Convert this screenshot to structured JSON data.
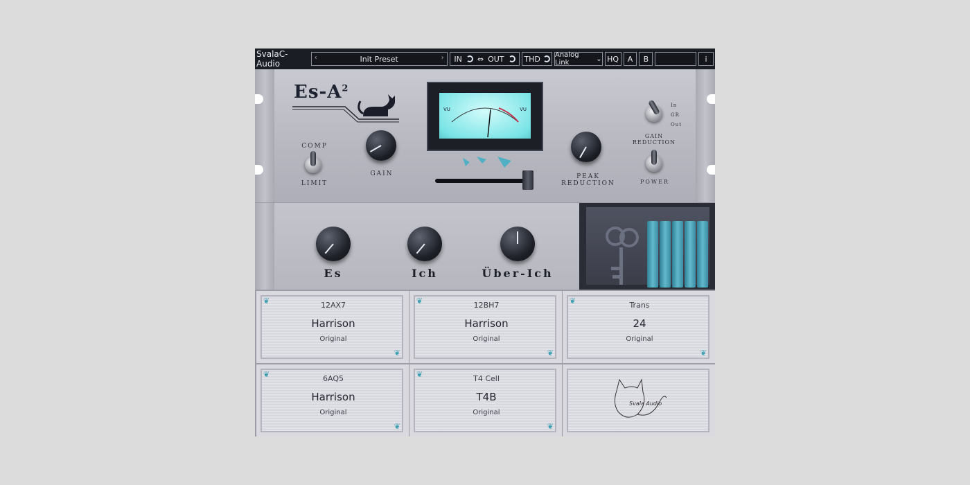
{
  "topbar": {
    "brand": "SvalaC-Audio",
    "preset_name": "Init Preset",
    "prev_arrow": "‹",
    "next_arrow": "›",
    "in_label": "IN",
    "link_symbol": "⇔",
    "out_label": "OUT",
    "thd_label": "THD",
    "analog_link_label": "Analog Link",
    "hq_label": "HQ",
    "a_label": "A",
    "b_label": "B",
    "info_label": "i"
  },
  "upper": {
    "logo": {
      "text": "Es-A",
      "superscript": "2"
    },
    "comp_label": "COMP",
    "limit_label": "LIMIT",
    "gain_label": "GAIN",
    "peak_reduction_label": "PEAK REDUCTION",
    "meter_mode_options": [
      "In",
      "GR",
      "Out"
    ],
    "gain_reduction_label": "GAIN REDUCTION",
    "power_label": "POWER",
    "vu_label_left": "VU",
    "vu_label_right": "VU"
  },
  "middle": {
    "knobs": [
      {
        "label": "Es"
      },
      {
        "label": "Ich"
      },
      {
        "label": "Über-Ich"
      }
    ]
  },
  "plates": [
    {
      "line1": "12AX7",
      "line2": "Harrison",
      "line3": "Original"
    },
    {
      "line1": "12BH7",
      "line2": "Harrison",
      "line3": "Original"
    },
    {
      "line1": "Trans",
      "line2": "24",
      "line3": "Original"
    },
    {
      "line1": "6AQ5",
      "line2": "Harrison",
      "line3": "Original"
    },
    {
      "line1": "T4 Cell",
      "line2": "T4B",
      "line3": "Original"
    }
  ],
  "signature": {
    "text": "Svala Audio"
  },
  "colors": {
    "accent_teal": "#3c9fb1",
    "vu_face": "#7ae4e6",
    "topbar": "#1a1d24"
  }
}
